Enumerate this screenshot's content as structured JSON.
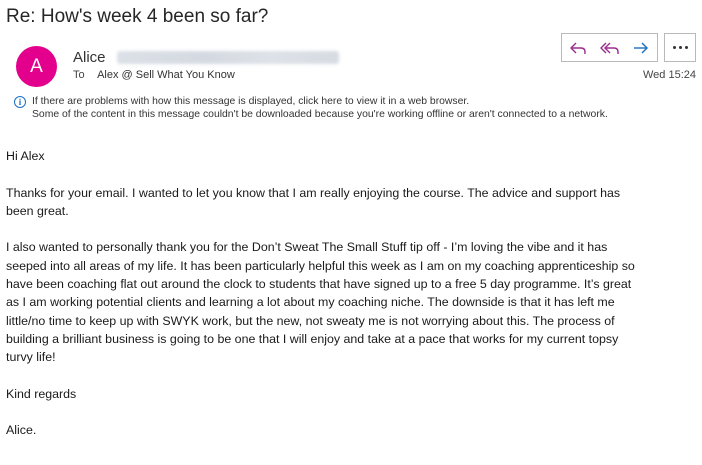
{
  "subject": "Re: How's week 4 been so far?",
  "sender": {
    "initial": "A",
    "name": "Alice",
    "avatar_color": "#e3008c"
  },
  "recipients": {
    "label": "To",
    "value": "Alex @ Sell What You Know"
  },
  "date": "Wed 15:24",
  "actions": {
    "reply_icon": "reply-icon",
    "reply_all_icon": "reply-all-icon",
    "forward_icon": "forward-icon",
    "more_icon": "more-icon",
    "accent": "#9b2d8f"
  },
  "info_bar": {
    "line1": "If there are problems with how this message is displayed, click here to view it in a web browser.",
    "line2": "Some of the content in this message couldn't be downloaded because you're working offline or aren't connected to a network."
  },
  "body": {
    "greeting": "Hi Alex",
    "paragraph1_line1": "Thanks for your email.  I wanted to let you know that I am really enjoying the course.  The advice and support has",
    "paragraph1_line2": "been great.",
    "paragraph2_line1": "I also wanted to personally thank you for the Don’t Sweat The Small Stuff tip off - I’m loving the vibe and it has",
    "paragraph2_line2": "seeped into all areas of my life.  It has been particularly helpful this week as I am on my coaching apprenticeship so",
    "paragraph2_line3": "have been coaching flat out around the clock to students that have signed up to a free 5 day programme.  It’s great",
    "paragraph2_line4": "as I am working potential clients and learning a lot about my coaching niche.  The downside is that it has left me",
    "paragraph2_line5": "little/no time to keep up with SWYK work, but the new, not sweaty me is not worrying about this.  The process of",
    "paragraph2_line6": "building a brilliant business is going to be one that I will enjoy and take at a pace that works for my current topsy",
    "paragraph2_line7": "turvy life!",
    "closing": "Kind regards",
    "signature": "Alice."
  }
}
